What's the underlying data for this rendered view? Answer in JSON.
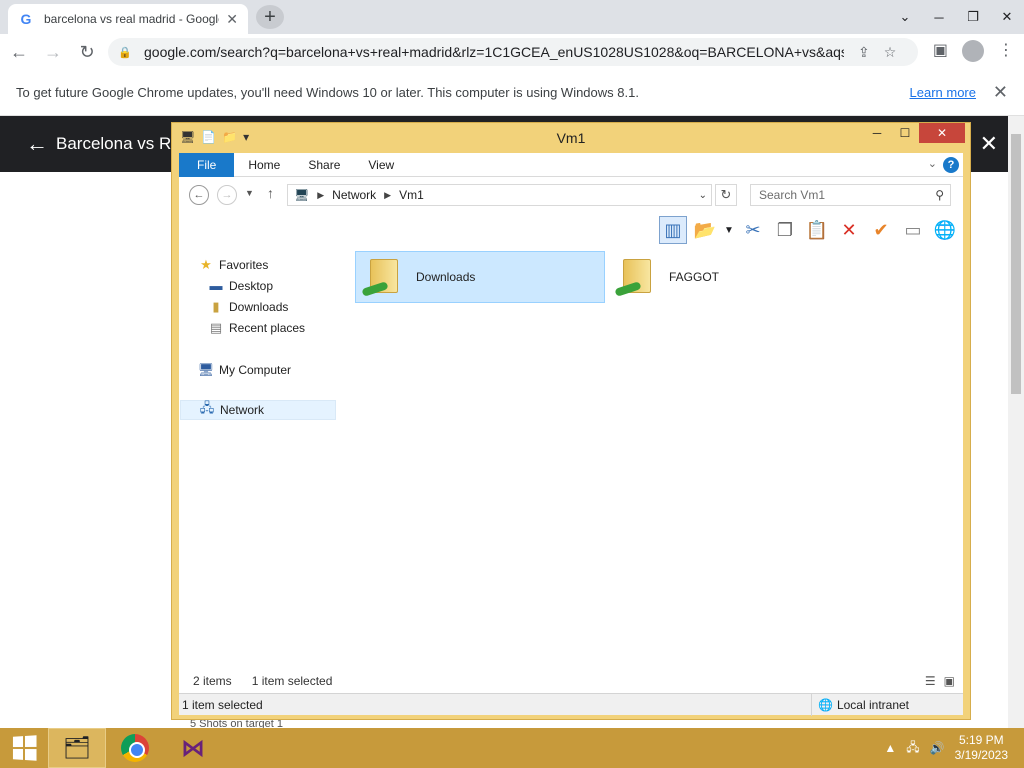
{
  "browser": {
    "tab_title": "barcelona vs real madrid - Google Search",
    "tab_favicon": "G",
    "url": "google.com/search?q=barcelona+vs+real+madrid&rlz=1C1GCEA_enUS1028US1028&oq=BARCELONA+vs&aqs...",
    "infobar_text": "To get future Google Chrome updates, you'll need Windows 10 or later. This computer is using Windows 8.1.",
    "infobar_link": "Learn more",
    "page_header": "Barcelona vs Re",
    "behind_text": "5                                    Shots on target                                    1"
  },
  "explorer": {
    "window_title": "Vm1",
    "ribbon_tabs": [
      "File",
      "Home",
      "Share",
      "View"
    ],
    "breadcrumb": [
      "Network",
      "Vm1"
    ],
    "search_placeholder": "Search Vm1",
    "nav": {
      "favorites": "Favorites",
      "desktop": "Desktop",
      "downloads": "Downloads",
      "recent": "Recent places",
      "my_computer": "My Computer",
      "network": "Network"
    },
    "files": [
      {
        "name": "Downloads",
        "selected": true
      },
      {
        "name": "FAGGOT",
        "selected": false
      }
    ],
    "status_items": "2 items",
    "status_selected": "1 item selected",
    "statusbar_text": "1 item selected",
    "zone": "Local intranet"
  },
  "taskbar": {
    "time": "5:19 PM",
    "date": "3/19/2023"
  },
  "colors": {
    "explorer_frame": "#f2d27a",
    "taskbar": "#c79a3b",
    "ribbon_file": "#1979ca",
    "close_button": "#c7463b"
  }
}
